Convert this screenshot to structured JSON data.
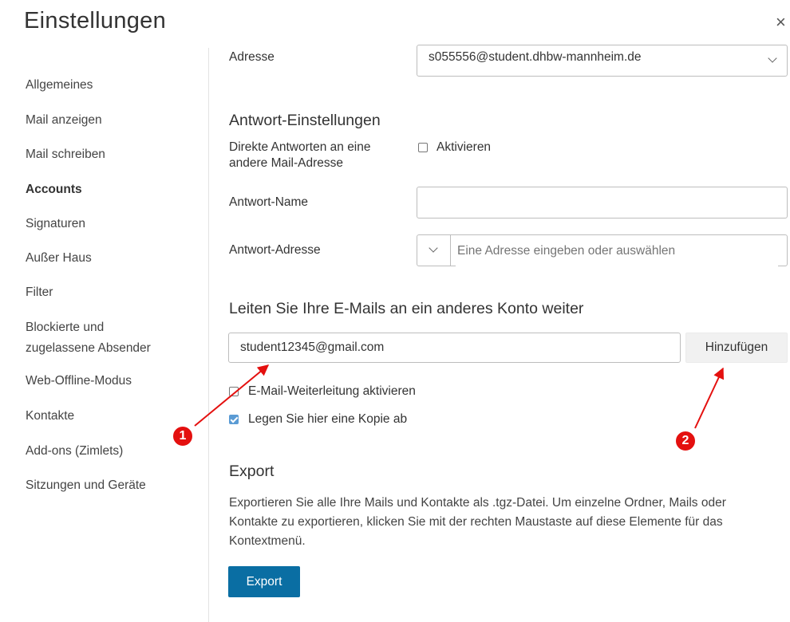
{
  "header": {
    "title": "Einstellungen",
    "close_symbol": "×"
  },
  "sidebar": {
    "items": [
      {
        "label": "Allgemeines"
      },
      {
        "label": "Mail anzeigen"
      },
      {
        "label": "Mail schreiben"
      },
      {
        "label": "Accounts",
        "active": true
      },
      {
        "label": "Signaturen"
      },
      {
        "label": "Außer Haus"
      },
      {
        "label": "Filter"
      },
      {
        "label": "Blockierte und",
        "label2": "zugelassene Absender"
      },
      {
        "label": "Web-Offline-Modus"
      },
      {
        "label": "Kontakte"
      },
      {
        "label": "Add-ons (Zimlets)"
      },
      {
        "label": "Sitzungen und Geräte"
      }
    ]
  },
  "account": {
    "address_label": "Adresse",
    "address_value": "s055556@student.dhbw-mannheim.de"
  },
  "reply": {
    "title": "Antwort-Einstellungen",
    "direct_label_line1": "Direkte Antworten an eine",
    "direct_label_line2": "andere Mail-Adresse",
    "activate_label": "Aktivieren",
    "name_label": "Antwort-Name",
    "name_value": "",
    "address_label": "Antwort-Adresse",
    "address_placeholder": "Eine Adresse eingeben oder auswählen"
  },
  "forward": {
    "title": "Leiten Sie Ihre E-Mails an ein anderes Konto weiter",
    "email_value": "student12345@gmail.com",
    "add_button": "Hinzufügen",
    "enable_label": "E-Mail-Weiterleitung aktivieren",
    "enable_checked": false,
    "keep_copy_label": "Legen Sie hier eine Kopie ab",
    "keep_copy_checked": true
  },
  "export": {
    "title": "Export",
    "description_line1": "Exportieren Sie alle Ihre Mails und Kontakte als .tgz-Datei. Um einzelne Ordner, Mails oder",
    "description_line2": "Kontakte zu exportieren, klicken Sie mit der rechten Maustaste auf diese Elemente für das",
    "description_line3": "Kontextmenü.",
    "button": "Export"
  },
  "annotations": {
    "badge1": "1",
    "badge2": "2",
    "color": "#e4100f"
  },
  "colors": {
    "primary_button": "#0a6ea3",
    "checkbox_checked": "#5a9bd4",
    "annotation_red": "#e4100f"
  }
}
